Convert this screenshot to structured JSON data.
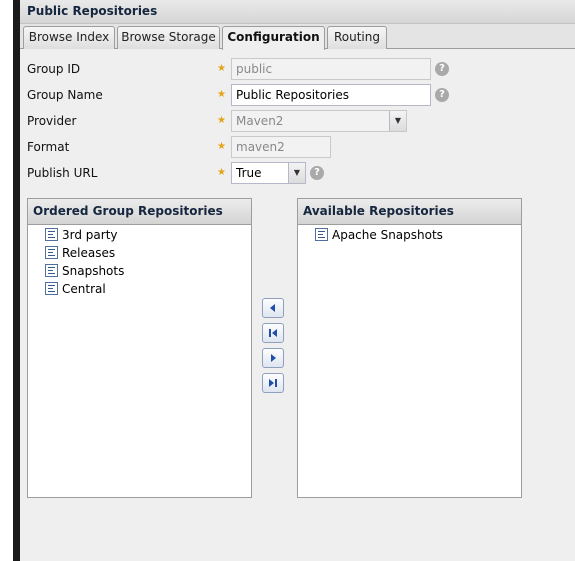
{
  "panel": {
    "title": "Public Repositories"
  },
  "tabs": [
    {
      "label": "Browse Index"
    },
    {
      "label": "Browse Storage"
    },
    {
      "label": "Configuration"
    },
    {
      "label": "Routing"
    }
  ],
  "form": {
    "group_id": {
      "label": "Group ID",
      "value": "public"
    },
    "group_name": {
      "label": "Group Name",
      "value": "Public Repositories"
    },
    "provider": {
      "label": "Provider",
      "value": "Maven2"
    },
    "format": {
      "label": "Format",
      "value": "maven2"
    },
    "publish_url": {
      "label": "Publish URL",
      "value": "True"
    }
  },
  "ordered": {
    "title": "Ordered Group Repositories",
    "items": [
      "3rd party",
      "Releases",
      "Snapshots",
      "Central"
    ]
  },
  "available": {
    "title": "Available Repositories",
    "items": [
      "Apache Snapshots"
    ]
  },
  "icons": {
    "required": "required-star-icon",
    "help": "help-icon",
    "repository": "repository-icon",
    "move_left": "move-left-icon",
    "move_all_left": "move-all-left-icon",
    "move_right": "move-right-icon",
    "move_all_right": "move-all-right-icon"
  }
}
